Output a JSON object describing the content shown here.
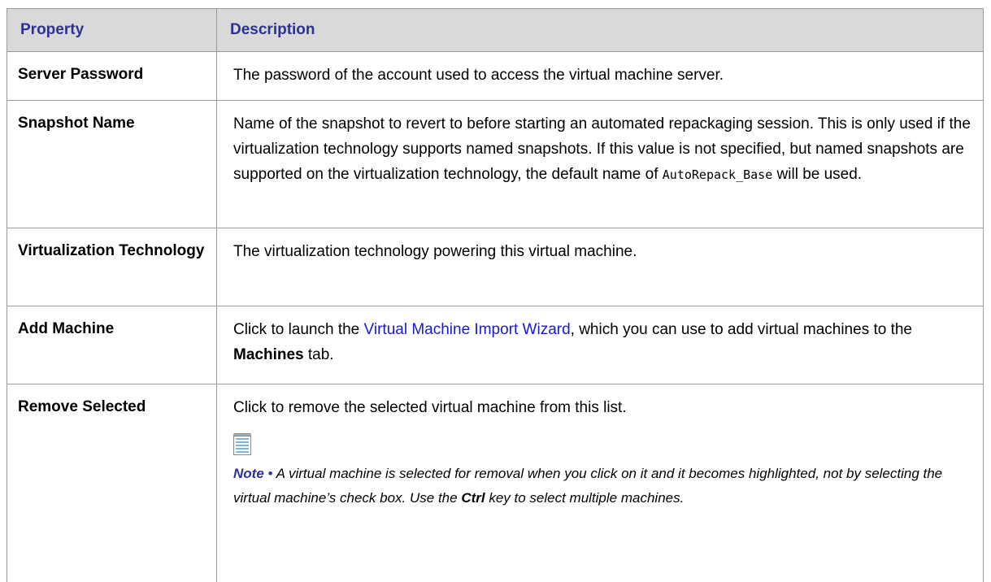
{
  "header": {
    "property": "Property",
    "description": "Description"
  },
  "rows": [
    {
      "property": "Server Password",
      "description": "The password of the account used to access the virtual machine server."
    },
    {
      "property": "Snapshot Name",
      "description_part1": "Name of the snapshot to revert to before starting an automated repackaging session. This is only used if the virtualization technology supports named snapshots. If this value is not specified, but named snapshots are supported on the virtualization technology, the default name of ",
      "code": "AutoRepack_Base",
      "description_part2": " will be used."
    },
    {
      "property": "Virtualization Technology",
      "description": "The virtualization technology powering this virtual machine."
    },
    {
      "property": "Add Machine",
      "description_part1": "Click to launch the ",
      "link": "Virtual Machine Import Wizard",
      "description_part2": ", which you can use to add virtual machines to the ",
      "bold": "Machines",
      "description_part3": " tab."
    },
    {
      "property": "Remove Selected",
      "description": "Click to remove the selected virtual machine from this list.",
      "note_icon": "note-icon",
      "note": {
        "label": "Note",
        "bullet": "•",
        "text_part1": "A virtual machine is selected for removal when you click on it and it becomes highlighted, not by selecting the virtual machine’s check box. Use the ",
        "key": "Ctrl",
        "text_part2": " key to select multiple machines."
      }
    }
  ],
  "colors": {
    "header_bg": "#d9d9d9",
    "header_text": "#2e3192",
    "link": "#1a19d1",
    "border": "#9a9a9a"
  }
}
